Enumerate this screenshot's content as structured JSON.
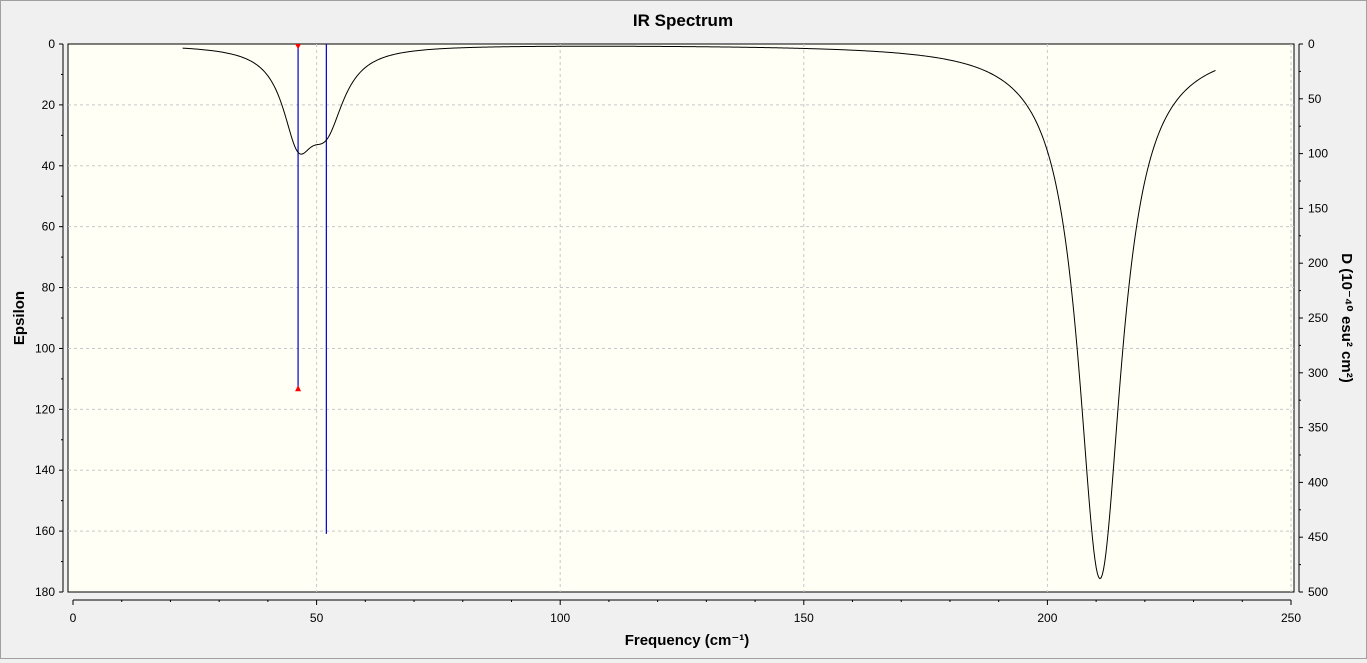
{
  "chart_data": {
    "type": "line",
    "title": "IR Spectrum",
    "xlabel": "Frequency (cm⁻¹)",
    "ylabel": "Epsilon",
    "y2label": "D (10⁻⁴⁰ esu² cm²)",
    "xlim": [
      0,
      250
    ],
    "ylim": [
      0,
      180
    ],
    "y2lim": [
      0,
      500
    ],
    "y_inverted": true,
    "grid": true,
    "x_ticks": [
      0,
      50,
      100,
      150,
      200,
      250
    ],
    "y_ticks": [
      0,
      20,
      40,
      60,
      80,
      100,
      120,
      140,
      160,
      180
    ],
    "y2_ticks": [
      0,
      50,
      100,
      150,
      200,
      250,
      300,
      350,
      400,
      450,
      500
    ],
    "colors": {
      "plot_background": "#fffff5",
      "spectrum_line": "#000000",
      "stick_line": "#0000cc",
      "marker": "#ff0000",
      "grid": "#c8c8c8"
    },
    "peaks": [
      {
        "frequency": 46.2,
        "epsilon": 26.7,
        "width": 7.7
      },
      {
        "frequency": 52.0,
        "epsilon": 23.2,
        "width": 9.0
      },
      {
        "frequency": 210.8,
        "epsilon": 175.6,
        "width": 10.8
      }
    ],
    "spectrum_x_range": [
      22.5,
      234.5
    ],
    "sticks": [
      {
        "frequency": 46.2,
        "intensity": 315
      },
      {
        "frequency": 52.0,
        "intensity": 447
      },
      {
        "frequency": 210.8,
        "intensity": 0
      }
    ],
    "selected_stick": {
      "frequency": 46.2,
      "intensity": 315
    }
  }
}
